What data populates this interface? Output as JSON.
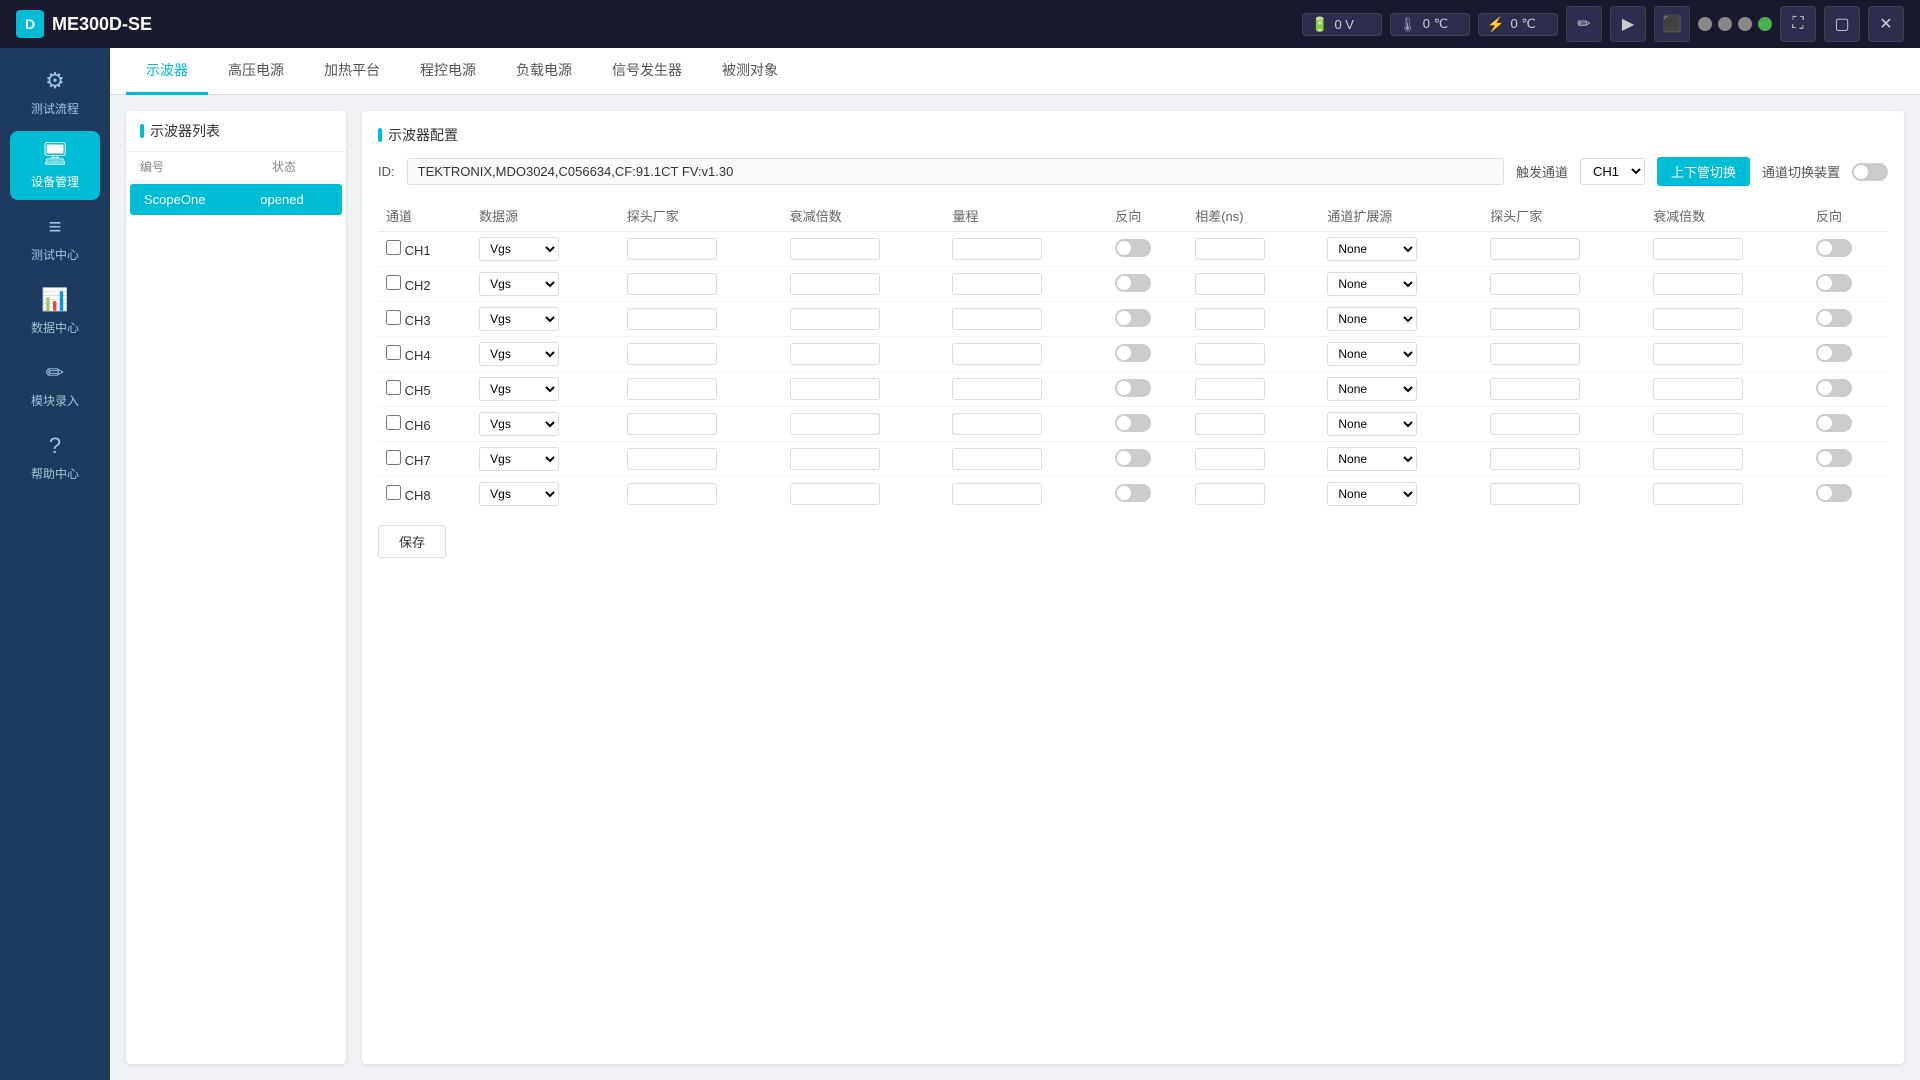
{
  "app": {
    "title": "ME300D-SE",
    "logo_letter": "D"
  },
  "topbar": {
    "meter1": {
      "icon": "🔋",
      "value": "0 V"
    },
    "meter2": {
      "icon": "🌡",
      "value": "0 ℃"
    },
    "meter3": {
      "icon": "⚡",
      "value": "0 ℃"
    },
    "dots": [
      "gray",
      "gray",
      "gray",
      "green"
    ],
    "buttons": [
      "✏",
      "▶",
      "⬛",
      "▢",
      "✕"
    ]
  },
  "sidebar": {
    "items": [
      {
        "id": "test-flow",
        "icon": "⚙",
        "label": "测试流程"
      },
      {
        "id": "device-mgmt",
        "icon": "🖥",
        "label": "设备管理",
        "active": true
      },
      {
        "id": "test-center",
        "icon": "≡",
        "label": "测试中心"
      },
      {
        "id": "data-center",
        "icon": "📊",
        "label": "数据中心"
      },
      {
        "id": "module-entry",
        "icon": "✏",
        "label": "模块录入"
      },
      {
        "id": "help-center",
        "icon": "?",
        "label": "帮助中心"
      }
    ]
  },
  "tabs": [
    {
      "id": "oscilloscope",
      "label": "示波器",
      "active": true
    },
    {
      "id": "hvps",
      "label": "高压电源"
    },
    {
      "id": "heating",
      "label": "加热平台"
    },
    {
      "id": "prog-power",
      "label": "程控电源"
    },
    {
      "id": "load-power",
      "label": "负载电源"
    },
    {
      "id": "signal-gen",
      "label": "信号发生器"
    },
    {
      "id": "test-target",
      "label": "被测对象"
    }
  ],
  "oscilloscope_list": {
    "title": "示波器列表",
    "headers": {
      "col1": "编号",
      "col2": "状态"
    },
    "rows": [
      {
        "id": "ScopeOne",
        "status": "opened",
        "selected": true
      }
    ]
  },
  "oscilloscope_config": {
    "title": "示波器配置",
    "id_label": "ID:",
    "id_value": "TEKTRONIX,MDO3024,C056634,CF:91.1CT FV:v1.30",
    "trigger_label": "触发通道",
    "trigger_value": "CH1",
    "switch_button": "上下管切换",
    "channel_switch_label": "通道切换装置",
    "columns": [
      "通道",
      "数据源",
      "探头厂家",
      "衰减倍数",
      "量程",
      "反向",
      "相差(ns)",
      "通道扩展源",
      "探头厂家",
      "衰减倍数",
      "反向"
    ],
    "channels": [
      {
        "id": "CH1",
        "datasource": "Vgs",
        "expand": "None"
      },
      {
        "id": "CH2",
        "datasource": "Vgs",
        "expand": "None"
      },
      {
        "id": "CH3",
        "datasource": "Vgs",
        "expand": "None"
      },
      {
        "id": "CH4",
        "datasource": "Vgs",
        "expand": "None"
      },
      {
        "id": "CH5",
        "datasource": "Vgs",
        "expand": "None"
      },
      {
        "id": "CH6",
        "datasource": "Vgs",
        "expand": "None"
      },
      {
        "id": "CH7",
        "datasource": "Vgs",
        "expand": "None"
      },
      {
        "id": "CH8",
        "datasource": "Vgs",
        "expand": "None"
      }
    ],
    "save_button": "保存"
  }
}
